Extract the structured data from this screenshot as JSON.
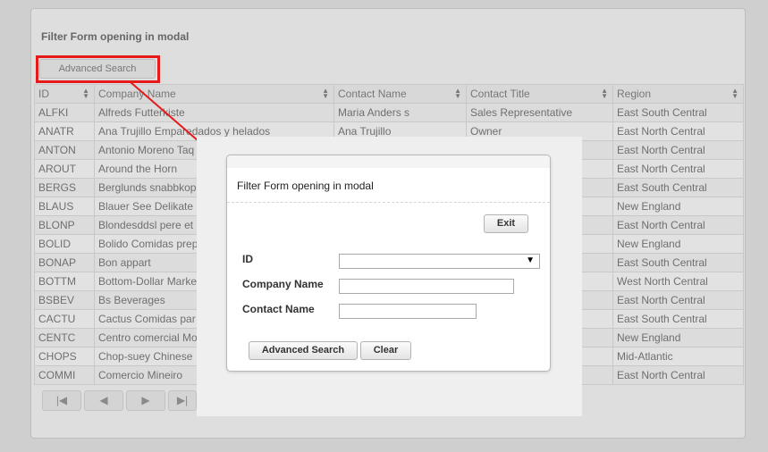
{
  "page": {
    "title": "Filter Form opening in modal",
    "advanced_search_label": "Advanced Search"
  },
  "grid": {
    "columns": [
      "ID",
      "Company Name",
      "Contact Name",
      "Contact Title",
      "Region"
    ],
    "rows": [
      [
        "ALFKI",
        "Alfreds Futterkiste",
        "Maria Anders s",
        "Sales Representative",
        "East South Central"
      ],
      [
        "ANATR",
        "Ana Trujillo Emparedados y helados",
        "Ana Trujillo",
        "Owner",
        "East North Central"
      ],
      [
        "ANTON",
        "Antonio Moreno Taq",
        "",
        "",
        "East North Central"
      ],
      [
        "AROUT",
        "Around the Horn",
        "",
        "",
        "East North Central"
      ],
      [
        "BERGS",
        "Berglunds snabbkop",
        "",
        "",
        "East South Central"
      ],
      [
        "BLAUS",
        "Blauer See Delikate",
        "",
        "",
        "New England"
      ],
      [
        "BLONP",
        "Blondesddsl pere et",
        "",
        "",
        "East North Central"
      ],
      [
        "BOLID",
        "Bolido Comidas prep",
        "",
        "",
        "New England"
      ],
      [
        "BONAP",
        "Bon appart",
        "",
        "",
        "East South Central"
      ],
      [
        "BOTTM",
        "Bottom-Dollar Marke",
        "",
        "",
        "West North Central"
      ],
      [
        "BSBEV",
        "Bs Beverages",
        "",
        "",
        "East North Central"
      ],
      [
        "CACTU",
        "Cactus Comidas par",
        "",
        "",
        "East South Central"
      ],
      [
        "CENTC",
        "Centro comercial Mo",
        "",
        "",
        "New England"
      ],
      [
        "CHOPS",
        "Chop-suey Chinese",
        "",
        "",
        "Mid-Atlantic"
      ],
      [
        "COMMI",
        "Comercio Mineiro",
        "",
        "",
        "East North Central"
      ]
    ]
  },
  "pager": {
    "icons": [
      "first-page-icon",
      "previous-page-icon",
      "next-page-icon",
      "last-page-icon"
    ]
  },
  "modal": {
    "title": "Filter Form opening in modal",
    "exit_label": "Exit",
    "fields": {
      "id_label": "ID",
      "id_value": "",
      "company_label": "Company Name",
      "company_value": "",
      "contact_label": "Contact Name",
      "contact_value": ""
    },
    "advanced_search_label": "Advanced Search",
    "clear_label": "Clear"
  },
  "colors": {
    "highlight": "#e51b1b",
    "overlay": "#cfcfcf"
  }
}
